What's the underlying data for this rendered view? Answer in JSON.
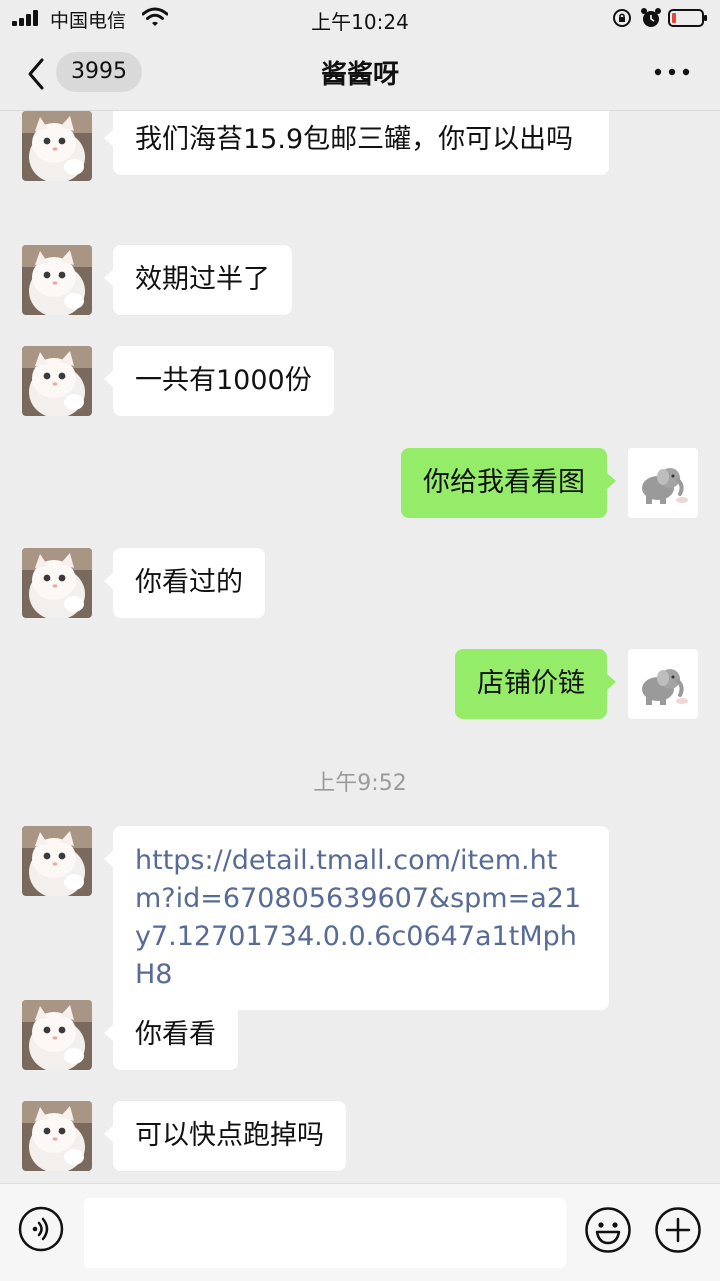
{
  "status_bar": {
    "carrier": "中国电信",
    "time": "上午10:24"
  },
  "nav": {
    "unread_count": "3995",
    "title": "酱酱呀"
  },
  "messages": [
    {
      "side": "left",
      "text": "我们海苔15.9包邮三罐，你可以出吗"
    },
    {
      "side": "left",
      "text": "效期过半了"
    },
    {
      "side": "left",
      "text": "一共有1000份"
    },
    {
      "side": "right",
      "text": "你给我看看图"
    },
    {
      "side": "left",
      "text": "你看过的"
    },
    {
      "side": "right",
      "text": "店铺价链"
    },
    {
      "side": "time",
      "text": "上午9:52"
    },
    {
      "side": "left",
      "text": "https://detail.tmall.com/item.htm?id=670805639607&spm=a21y7.12701734.0.0.6c0647a1tMphH8",
      "is_link": true
    },
    {
      "side": "left",
      "text": "你看看"
    },
    {
      "side": "left",
      "text": "可以快点跑掉吗"
    }
  ],
  "colors": {
    "background": "#ededed",
    "my_bubble": "#95ec69",
    "their_bubble": "#ffffff",
    "link": "#576b95"
  },
  "icons": {
    "back": "chevron-left-icon",
    "more": "more-dots-icon",
    "voice": "voice-icon",
    "emoji": "emoji-icon",
    "plus": "plus-icon"
  }
}
